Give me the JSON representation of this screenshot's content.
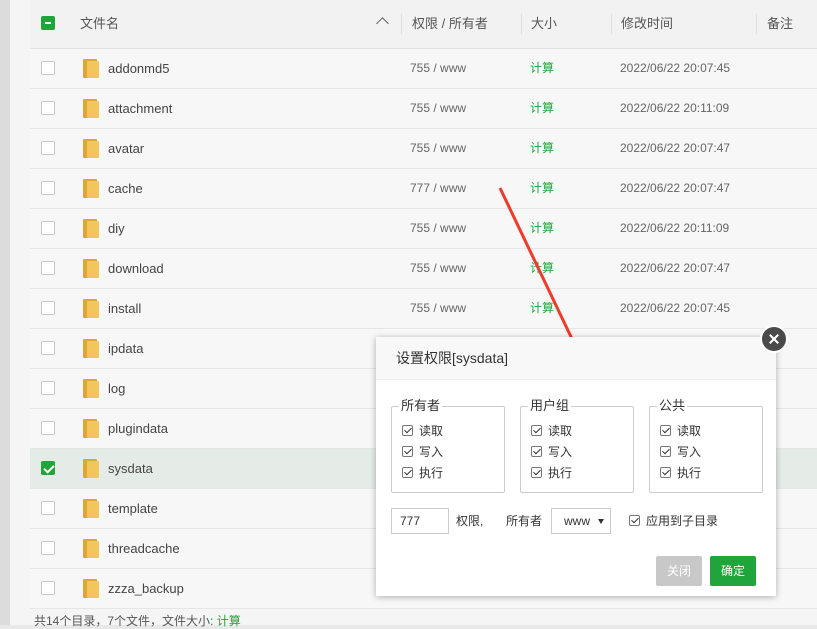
{
  "table": {
    "headers": {
      "name": "文件名",
      "perm": "权限 / 所有者",
      "size": "大小",
      "mtime": "修改时间",
      "note": "备注"
    },
    "rows": [
      {
        "name": "addonmd5",
        "perm": "755 / www",
        "size": "计算",
        "mtime": "2022/06/22 20:07:45",
        "checked": false
      },
      {
        "name": "attachment",
        "perm": "755 / www",
        "size": "计算",
        "mtime": "2022/06/22 20:11:09",
        "checked": false
      },
      {
        "name": "avatar",
        "perm": "755 / www",
        "size": "计算",
        "mtime": "2022/06/22 20:07:47",
        "checked": false
      },
      {
        "name": "cache",
        "perm": "777 / www",
        "size": "计算",
        "mtime": "2022/06/22 20:07:47",
        "checked": false
      },
      {
        "name": "diy",
        "perm": "755 / www",
        "size": "计算",
        "mtime": "2022/06/22 20:11:09",
        "checked": false
      },
      {
        "name": "download",
        "perm": "755 / www",
        "size": "计算",
        "mtime": "2022/06/22 20:07:47",
        "checked": false
      },
      {
        "name": "install",
        "perm": "755 / www",
        "size": "计算",
        "mtime": "2022/06/22 20:07:45",
        "checked": false
      },
      {
        "name": "ipdata",
        "perm": "",
        "size": "",
        "mtime": "",
        "checked": false
      },
      {
        "name": "log",
        "perm": "",
        "size": "",
        "mtime": "",
        "checked": false
      },
      {
        "name": "plugindata",
        "perm": "",
        "size": "",
        "mtime": "",
        "checked": false
      },
      {
        "name": "sysdata",
        "perm": "",
        "size": "",
        "mtime": "",
        "checked": true
      },
      {
        "name": "template",
        "perm": "",
        "size": "",
        "mtime": "",
        "checked": false
      },
      {
        "name": "threadcache",
        "perm": "",
        "size": "",
        "mtime": "",
        "checked": false
      },
      {
        "name": "zzza_backup",
        "perm": "",
        "size": "",
        "mtime": "",
        "checked": false
      }
    ]
  },
  "footer": {
    "text": "共14个目录，7个文件，文件大小:",
    "link": "计算"
  },
  "modal": {
    "title": "设置权限[sysdata]",
    "groups": [
      {
        "label": "所有者",
        "options": [
          "读取",
          "写入",
          "执行"
        ]
      },
      {
        "label": "用户组",
        "options": [
          "读取",
          "写入",
          "执行"
        ]
      },
      {
        "label": "公共",
        "options": [
          "读取",
          "写入",
          "执行"
        ]
      }
    ],
    "perm_value": "777",
    "perm_label": "权限,",
    "owner_label": "所有者",
    "owner_value": "www",
    "apply_label": "应用到子目录",
    "close_label": "关闭",
    "ok_label": "确定"
  },
  "colors": {
    "accent": "#20a53a",
    "arrow": "#f03a2a"
  }
}
